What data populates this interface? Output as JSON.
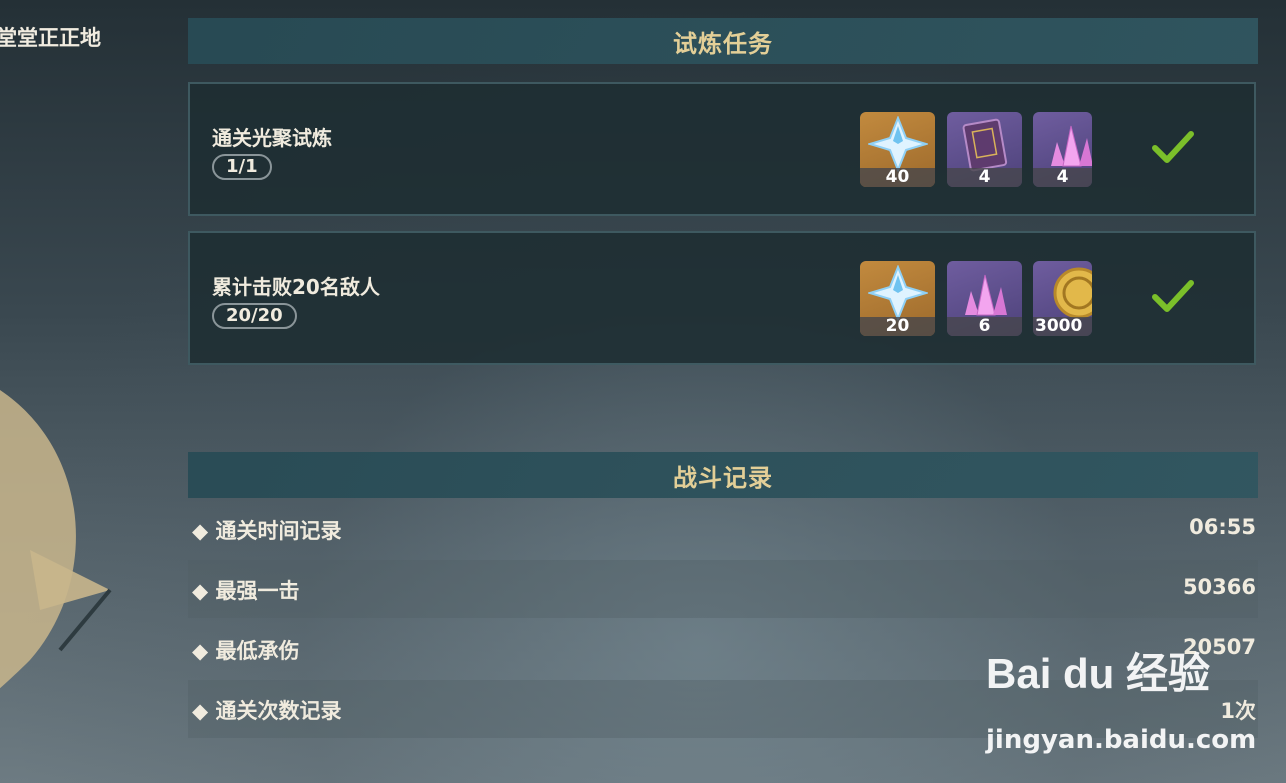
{
  "top_left": {
    "text": "堂堂正正地"
  },
  "tasks_section": {
    "title": "试炼任务"
  },
  "tasks": [
    {
      "title": "通关光聚试炼",
      "progress": "1/1",
      "rewards": [
        {
          "icon": "primogem-icon",
          "count": "40",
          "bg": "gold"
        },
        {
          "icon": "book-icon",
          "count": "4",
          "bg": "purple"
        },
        {
          "icon": "crystal-icon",
          "count": "4",
          "bg": "purple"
        }
      ],
      "completed": true
    },
    {
      "title": "累计击败20名敌人",
      "progress": "20/20",
      "rewards": [
        {
          "icon": "primogem-icon",
          "count": "20",
          "bg": "gold"
        },
        {
          "icon": "crystal-icon",
          "count": "6",
          "bg": "purple"
        },
        {
          "icon": "mora-coin-icon",
          "count": "3000",
          "bg": "purple"
        }
      ],
      "completed": true
    }
  ],
  "battle_section": {
    "title": "战斗记录"
  },
  "stats": [
    {
      "label": "◆ 通关时间记录",
      "value": "06:55"
    },
    {
      "label": "◆ 最强一击",
      "value": "50366"
    },
    {
      "label": "◆ 最低承伤",
      "value": "20507"
    },
    {
      "label": "◆ 通关次数记录",
      "value": "1次"
    }
  ],
  "watermark": {
    "brand": "Bai du 经验",
    "url": "jingyan.baidu.com"
  },
  "colors": {
    "header_gold": "#e3cf97",
    "check_green": "#7bbf2a",
    "reward_gold": "#c28a3e",
    "reward_purple": "#6f5d9f"
  }
}
